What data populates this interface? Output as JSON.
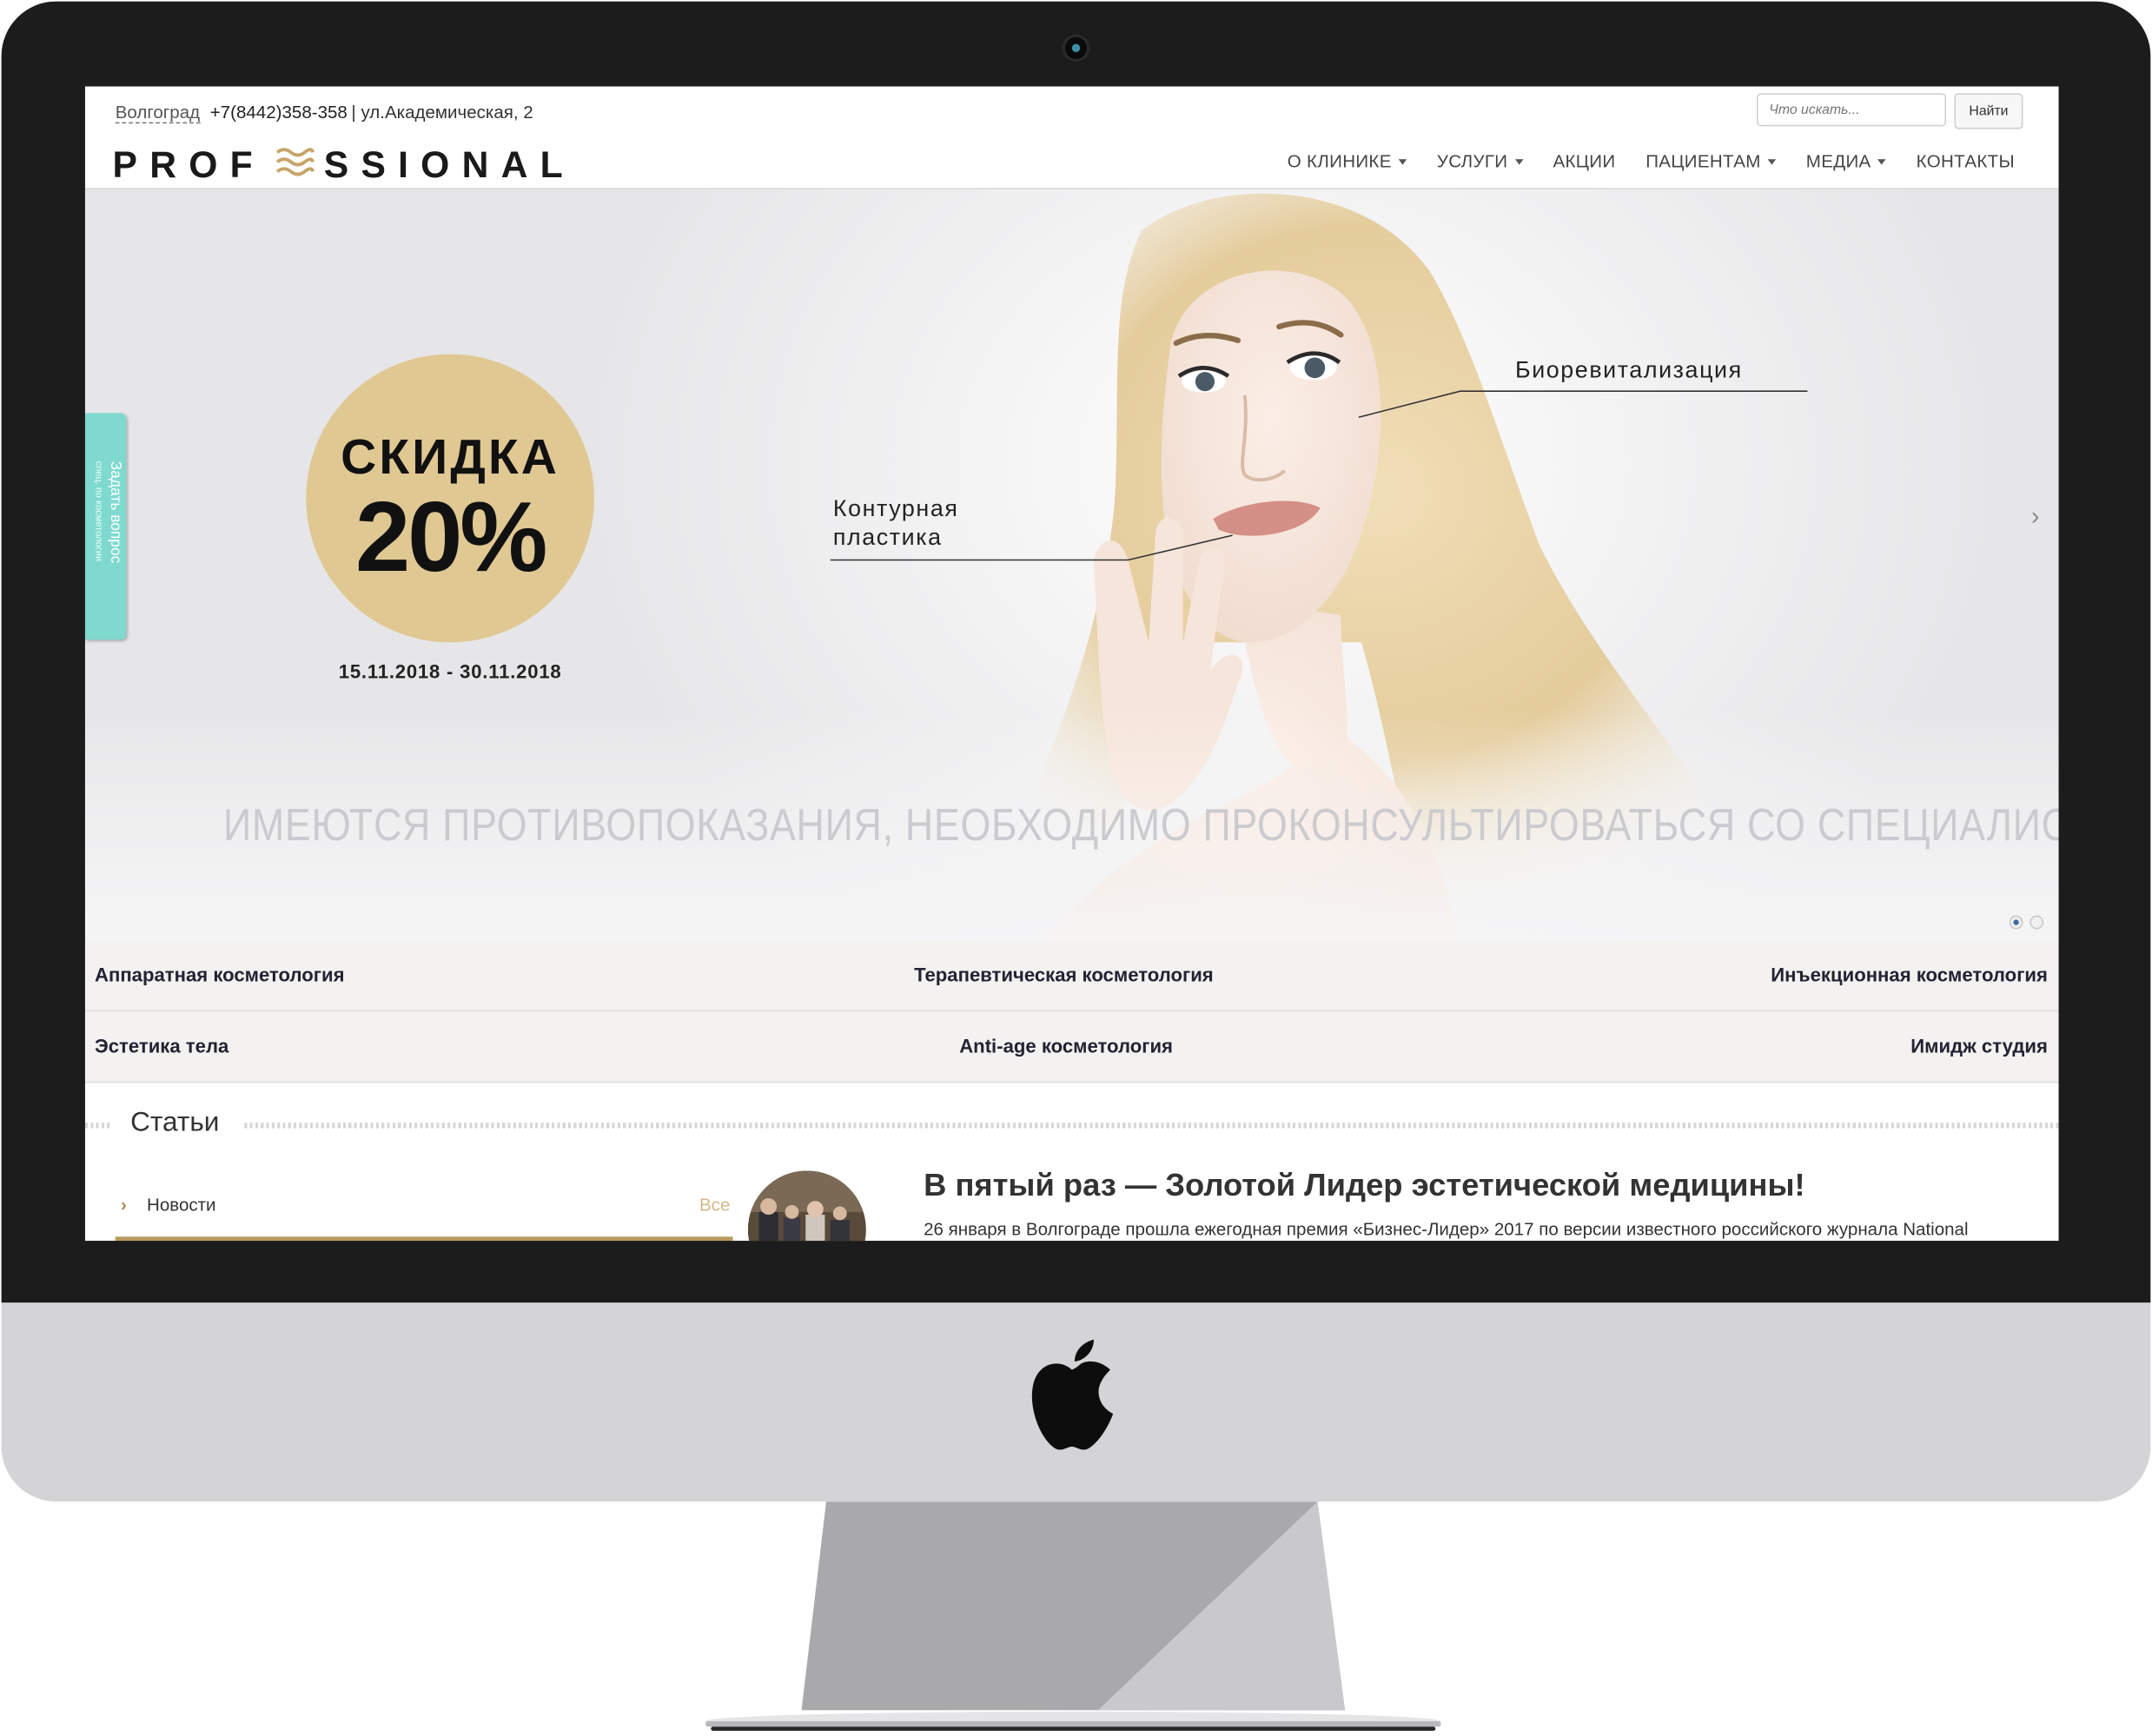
{
  "header": {
    "city": "Волгоград",
    "phone": "+7(8442)358-358",
    "address": "| ул.Академическая, 2",
    "logo_text": "PROFESSIONAL",
    "search": {
      "placeholder": "Что искать...",
      "button_label": "Найти"
    },
    "nav": [
      {
        "label": "О КЛИНИКЕ",
        "has_dropdown": true
      },
      {
        "label": "УСЛУГИ",
        "has_dropdown": true
      },
      {
        "label": "АКЦИИ",
        "has_dropdown": false
      },
      {
        "label": "ПАЦИЕНТАМ",
        "has_dropdown": true
      },
      {
        "label": "МЕДИА",
        "has_dropdown": true
      },
      {
        "label": "КОНТАКТЫ",
        "has_dropdown": false
      }
    ]
  },
  "hero": {
    "promo_title": "СКИДКА",
    "promo_value": "20%",
    "promo_dates": "15.11.2018 - 30.11.2018",
    "label_bio": "Биоревитализация",
    "label_contour_1": "Контурная",
    "label_contour_2": "пластика",
    "disclaimer": "ИМЕЮТСЯ ПРОТИВОПОКАЗАНИЯ, НЕОБХОДИМО ПРОКОНСУЛЬТИРОВАТЬСЯ СО СПЕЦИАЛИСТОМ",
    "side_tab_label": "Задать вопрос",
    "side_tab_sub": "спец. по косметологии",
    "slides_total": 2,
    "active_slide": 1
  },
  "categories": {
    "row1": [
      "Аппаратная косметология",
      "Терапевтическая косметология",
      "Инъекционная косметология"
    ],
    "row2": [
      "Эстетика тела",
      "Anti-age косметология",
      "Имидж студия"
    ]
  },
  "articles": {
    "section_title": "Статьи",
    "tab_label": "Новости",
    "all_link": "Все",
    "headline": "В пятый раз — Золотой Лидер эстетической медицины!",
    "lead": "26 января в Волгограде прошла ежегодная премия «Бизнес-Лидер» 2017 по версии известного российского журнала National"
  },
  "colors": {
    "gold": "#e0c893",
    "gold_dark": "#b89b5e",
    "mint": "#7fd9cf",
    "bezel": "#1c1c1c",
    "chassis": "#d4d4d6"
  }
}
